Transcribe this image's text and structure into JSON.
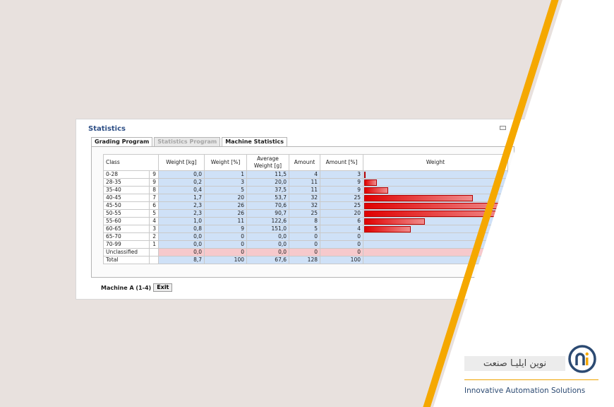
{
  "window": {
    "title": "Statistics",
    "tabs": [
      {
        "label": "Grading Program",
        "active": true
      },
      {
        "label": "Statistics Program",
        "active": false
      },
      {
        "label": "Machine Statistics",
        "active": false
      }
    ]
  },
  "table": {
    "headers": {
      "class": "Class",
      "weight_kg": "Weight [kg]",
      "weight_pct": "Weight [%]",
      "avg_weight": "Average Weight [g]",
      "amount": "Amount",
      "amount_pct": "Amount [%]",
      "weight_bar": "Weight"
    },
    "rows": [
      {
        "class": "0-28",
        "n": "9",
        "weight_kg": "0,0",
        "weight_pct": "1",
        "avg_weight": "11,5",
        "amount": "4",
        "amount_pct": "3",
        "bar_pct": 1
      },
      {
        "class": "28-35",
        "n": "9",
        "weight_kg": "0,2",
        "weight_pct": "3",
        "avg_weight": "20,0",
        "amount": "11",
        "amount_pct": "9",
        "bar_pct": 9
      },
      {
        "class": "35-40",
        "n": "8",
        "weight_kg": "0,4",
        "weight_pct": "5",
        "avg_weight": "37,5",
        "amount": "11",
        "amount_pct": "9",
        "bar_pct": 17
      },
      {
        "class": "40-45",
        "n": "7",
        "weight_kg": "1,7",
        "weight_pct": "20",
        "avg_weight": "53,7",
        "amount": "32",
        "amount_pct": "25",
        "bar_pct": 77
      },
      {
        "class": "45-50",
        "n": "6",
        "weight_kg": "2,3",
        "weight_pct": "26",
        "avg_weight": "70,6",
        "amount": "32",
        "amount_pct": "25",
        "bar_pct": 100
      },
      {
        "class": "50-55",
        "n": "5",
        "weight_kg": "2,3",
        "weight_pct": "26",
        "avg_weight": "90,7",
        "amount": "25",
        "amount_pct": "20",
        "bar_pct": 100
      },
      {
        "class": "55-60",
        "n": "4",
        "weight_kg": "1,0",
        "weight_pct": "11",
        "avg_weight": "122,6",
        "amount": "8",
        "amount_pct": "6",
        "bar_pct": 43
      },
      {
        "class": "60-65",
        "n": "3",
        "weight_kg": "0,8",
        "weight_pct": "9",
        "avg_weight": "151,0",
        "amount": "5",
        "amount_pct": "4",
        "bar_pct": 33
      },
      {
        "class": "65-70",
        "n": "2",
        "weight_kg": "0,0",
        "weight_pct": "0",
        "avg_weight": "0,0",
        "amount": "0",
        "amount_pct": "0",
        "bar_pct": 0
      },
      {
        "class": "70-99",
        "n": "1",
        "weight_kg": "0,0",
        "weight_pct": "0",
        "avg_weight": "0,0",
        "amount": "0",
        "amount_pct": "0",
        "bar_pct": 0
      },
      {
        "class": "Unclassified",
        "n": "",
        "weight_kg": "0,0",
        "weight_pct": "0",
        "avg_weight": "0,0",
        "amount": "0",
        "amount_pct": "0",
        "bar_pct": 0,
        "style": "pink"
      },
      {
        "class": "Total",
        "n": "",
        "weight_kg": "8,7",
        "weight_pct": "100",
        "avg_weight": "67,6",
        "amount": "128",
        "amount_pct": "100",
        "bar_pct": 0,
        "style": "total"
      }
    ]
  },
  "footer": {
    "machine_label": "Machine A (1-4)",
    "exit_label": "Exit"
  },
  "logo": {
    "persian_name": "نوین ایلیـا صنعت",
    "english_name": "Innovative Automation Solutions"
  },
  "colors": {
    "stripe": "#f5a800",
    "title": "#2e4f86",
    "row_blue": "#cfe1f7",
    "row_pink": "#f6c9cc",
    "bar": "#e00000"
  }
}
